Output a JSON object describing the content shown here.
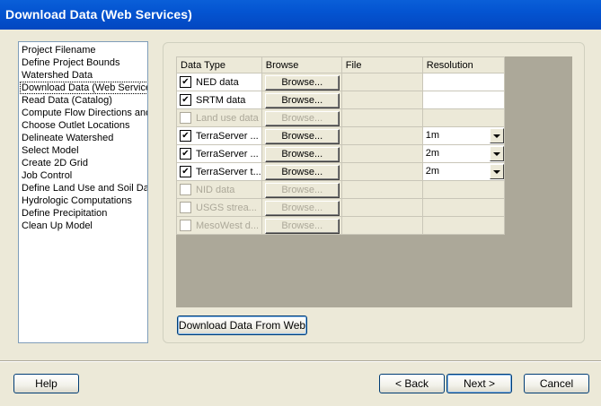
{
  "window": {
    "title": "Download Data (Web Services)"
  },
  "steps": [
    "Project Filename",
    "Define Project Bounds",
    "Watershed Data",
    "Download Data (Web Services)",
    "Read Data (Catalog)",
    "Compute Flow Directions and Accumulations",
    "Choose Outlet Locations",
    "Delineate Watershed",
    "Select Model",
    "Create 2D Grid",
    "Job Control",
    "Define Land Use and Soil Data",
    "Hydrologic Computations",
    "Define Precipitation",
    "Clean Up Model"
  ],
  "selected_step": "Download Data (Web Services)",
  "grid": {
    "columns": [
      "Data Type",
      "Browse",
      "File",
      "Resolution"
    ],
    "rows": [
      {
        "type": "NED data",
        "checked": true,
        "enabled": true,
        "browse": "Browse...",
        "file": "",
        "resolution": "",
        "dropdown": false
      },
      {
        "type": "SRTM data",
        "checked": true,
        "enabled": true,
        "browse": "Browse...",
        "file": "",
        "resolution": "",
        "dropdown": false
      },
      {
        "type": "Land use data",
        "checked": false,
        "enabled": false,
        "browse": "Browse...",
        "file": "",
        "resolution": "",
        "dropdown": false
      },
      {
        "type": "TerraServer ...",
        "checked": true,
        "enabled": true,
        "browse": "Browse...",
        "file": "",
        "resolution": "1m",
        "dropdown": true
      },
      {
        "type": "TerraServer ...",
        "checked": true,
        "enabled": true,
        "browse": "Browse...",
        "file": "",
        "resolution": "2m",
        "dropdown": true
      },
      {
        "type": "TerraServer t...",
        "checked": true,
        "enabled": true,
        "browse": "Browse...",
        "file": "",
        "resolution": "2m",
        "dropdown": true
      },
      {
        "type": "NID data",
        "checked": false,
        "enabled": false,
        "browse": "Browse...",
        "file": "",
        "resolution": "",
        "dropdown": false
      },
      {
        "type": "USGS strea...",
        "checked": false,
        "enabled": false,
        "browse": "Browse...",
        "file": "",
        "resolution": "",
        "dropdown": false
      },
      {
        "type": "MesoWest d...",
        "checked": false,
        "enabled": false,
        "browse": "Browse...",
        "file": "",
        "resolution": "",
        "dropdown": false
      }
    ]
  },
  "buttons": {
    "download": "Download Data From Web",
    "help": "Help",
    "back": "< Back",
    "next": "Next >",
    "cancel": "Cancel"
  }
}
